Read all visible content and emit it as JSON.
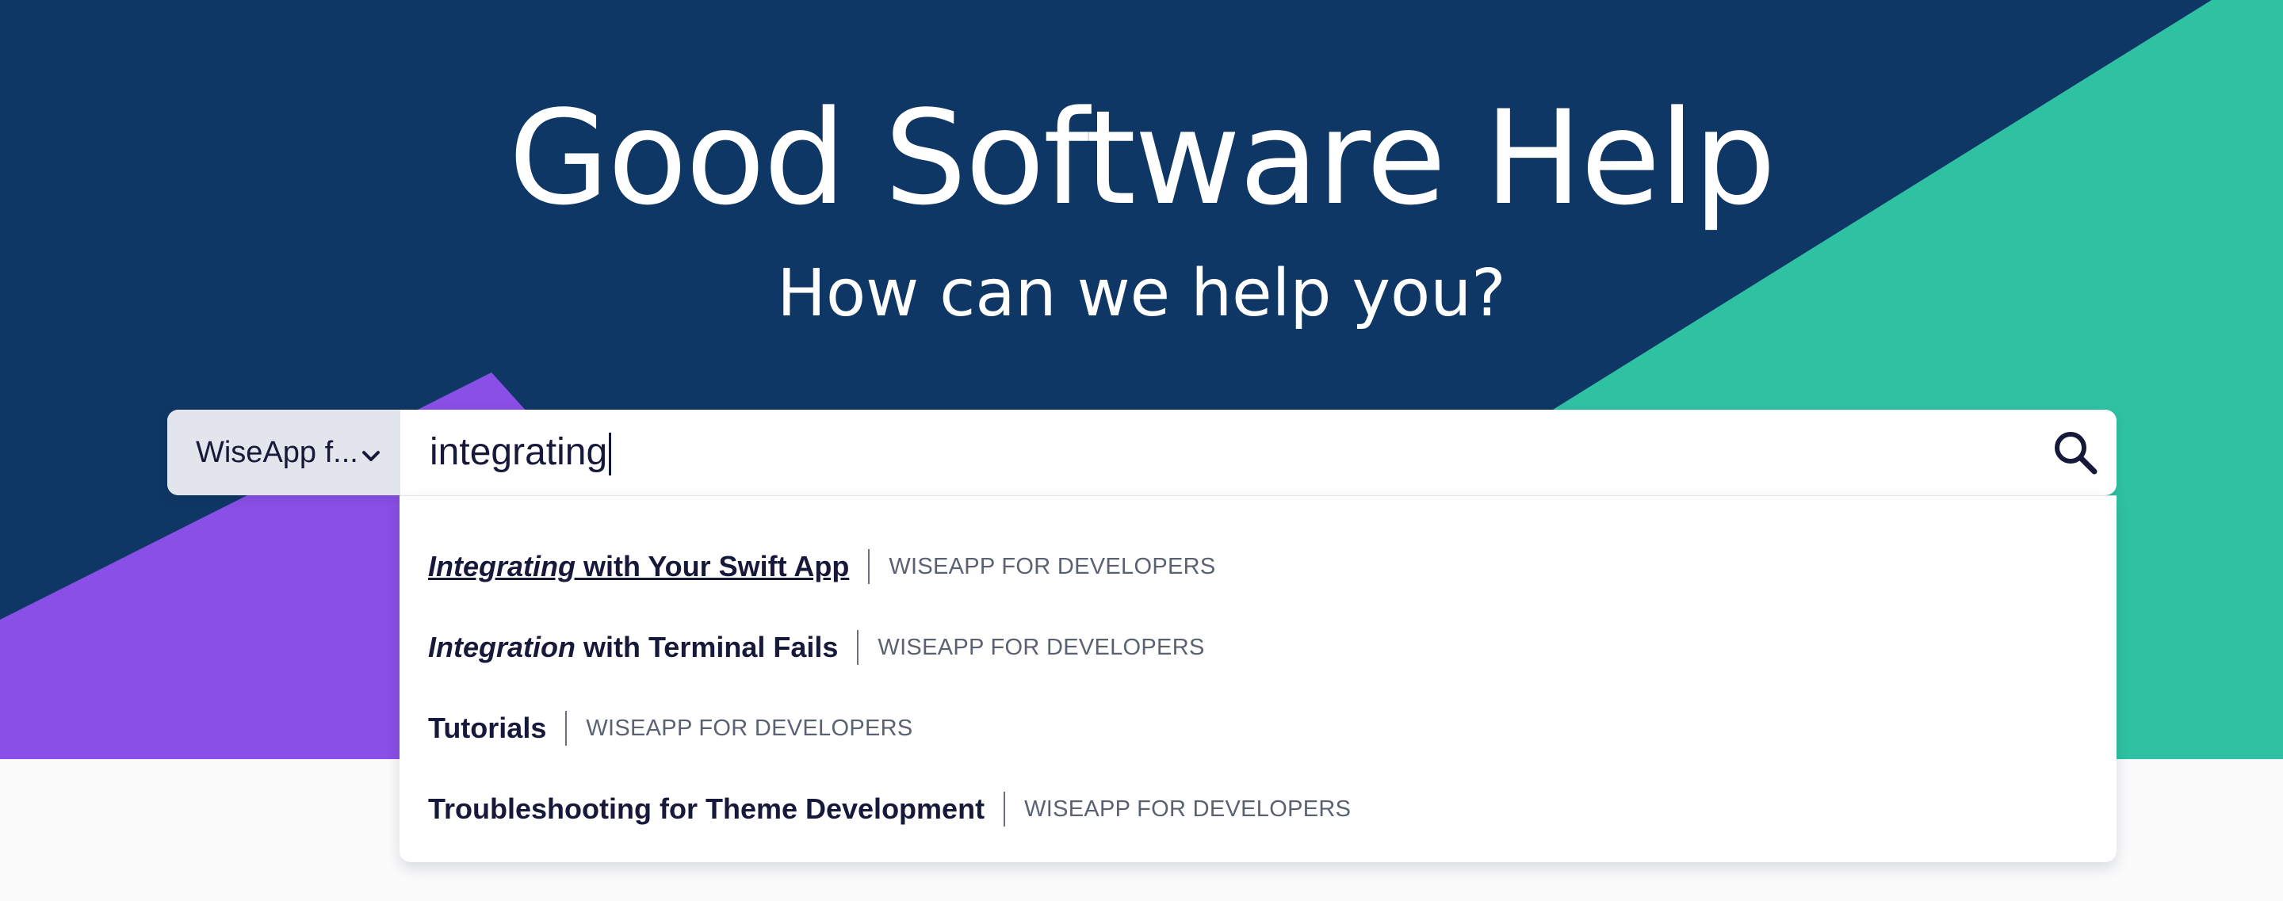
{
  "hero": {
    "title": "Good Software Help",
    "subtitle": "How can we help you?",
    "colors": {
      "background": "#0f3765",
      "green": "#2fc2a2",
      "purple": "#8a4fe6"
    }
  },
  "search": {
    "scope_label": "WiseApp f...",
    "query": "integrating",
    "scope_icon": "chevron-down-icon",
    "submit_icon": "search-icon"
  },
  "suggestions": [
    {
      "highlight": "Integrating",
      "rest": " with Your Swift App",
      "category": "WISEAPP FOR DEVELOPERS",
      "active": true
    },
    {
      "highlight": "Integration",
      "rest": " with Terminal Fails",
      "category": "WISEAPP FOR DEVELOPERS",
      "active": false
    },
    {
      "highlight": "",
      "rest": "Tutorials",
      "category": "WISEAPP FOR DEVELOPERS",
      "active": false
    },
    {
      "highlight": "",
      "rest": "Troubleshooting for Theme Development",
      "category": "WISEAPP FOR DEVELOPERS",
      "active": false
    }
  ]
}
